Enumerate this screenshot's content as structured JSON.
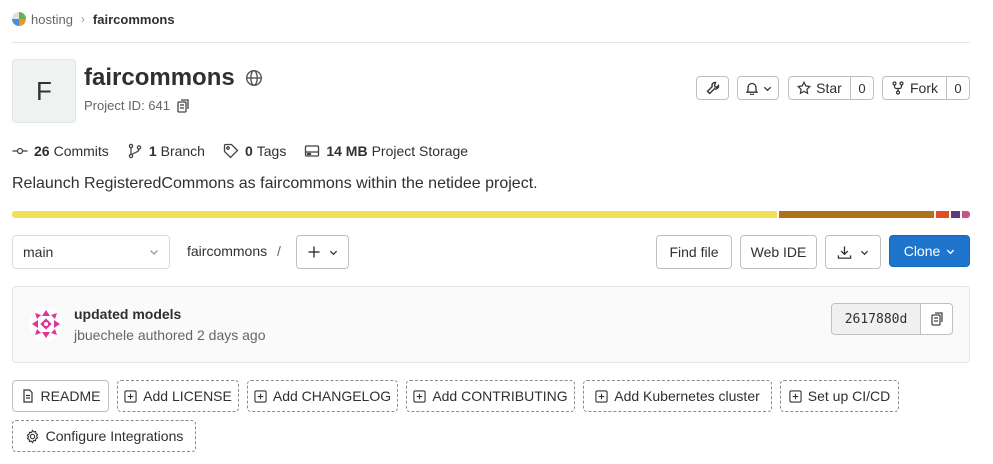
{
  "breadcrumb": {
    "parent": "hosting",
    "current": "faircommons"
  },
  "project": {
    "initial": "F",
    "name": "faircommons",
    "id_label": "Project ID: 641"
  },
  "actions": {
    "star_label": "Star",
    "star_count": "0",
    "fork_label": "Fork",
    "fork_count": "0"
  },
  "stats": [
    {
      "icon": "commit-icon",
      "value": "26",
      "label": "Commits"
    },
    {
      "icon": "branch-icon",
      "value": "1",
      "label": "Branch"
    },
    {
      "icon": "tag-icon",
      "value": "0",
      "label": "Tags"
    },
    {
      "icon": "storage-icon",
      "value": "14 MB",
      "label": "Project Storage"
    }
  ],
  "description": "Relaunch RegisteredCommons as faircommons within the netidee project.",
  "language_bar": [
    {
      "fraction": 0.802,
      "color": "#f1e05a"
    },
    {
      "fraction": 0.162,
      "color": "#b07219"
    },
    {
      "fraction": 0.014,
      "color": "#e34c26"
    },
    {
      "fraction": 0.01,
      "color": "#563d7c"
    },
    {
      "fraction": 0.008,
      "color": "#c6538c"
    }
  ],
  "repo": {
    "branch": "main",
    "path": "faircommons",
    "path_sep": "/",
    "find_file": "Find file",
    "web_ide": "Web IDE",
    "clone": "Clone"
  },
  "commit": {
    "title": "updated models",
    "meta": "jbuechele authored 2 days ago",
    "sha": "2617880d"
  },
  "quick_actions": [
    {
      "label": "README",
      "style": "solid",
      "icon": "file-icon"
    },
    {
      "label": "Add LICENSE",
      "style": "dashed",
      "icon": "plus-square-icon"
    },
    {
      "label": "Add CHANGELOG",
      "style": "dashed",
      "icon": "plus-square-icon"
    },
    {
      "label": "Add CONTRIBUTING",
      "style": "dashed",
      "icon": "plus-square-icon"
    },
    {
      "label": "Add Kubernetes cluster",
      "style": "dashed",
      "icon": "plus-square-icon"
    },
    {
      "label": "Set up CI/CD",
      "style": "dashed",
      "icon": "plus-square-icon"
    },
    {
      "label": "Configure Integrations",
      "style": "dashed",
      "icon": "settings-icon"
    }
  ]
}
